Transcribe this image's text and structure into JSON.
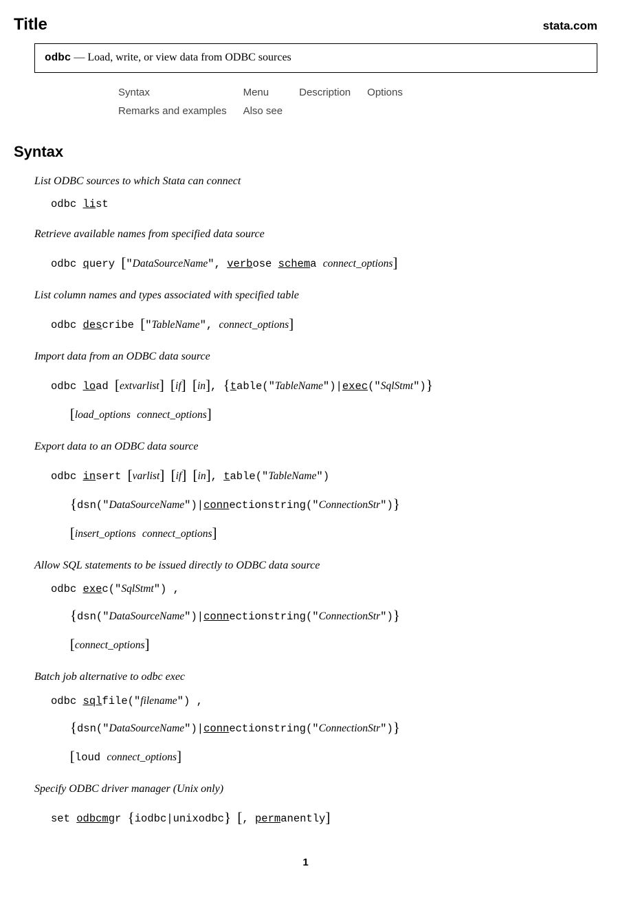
{
  "header": {
    "title": "Title",
    "site": "stata.com"
  },
  "titlebox": {
    "cmd": "odbc",
    "dash": " — ",
    "desc": "Load, write, or view data from ODBC sources"
  },
  "nav": {
    "r1c1": "Syntax",
    "r1c2": "Menu",
    "r1c3": "Description",
    "r1c4": "Options",
    "r2c1": "Remarks and examples",
    "r2c2": "Also see"
  },
  "section": "Syntax",
  "e1": {
    "desc": "List ODBC sources to which Stata can connect"
  },
  "e2": {
    "desc": "Retrieve available names from specified data source"
  },
  "e3": {
    "desc": "List column names and types associated with specified table"
  },
  "e4": {
    "desc": "Import data from an ODBC data source"
  },
  "e5": {
    "desc": "Export data to an ODBC data source"
  },
  "e6": {
    "desc": "Allow SQL statements to be issued directly to ODBC data source"
  },
  "e7": {
    "desc": "Batch job alternative to odbc exec"
  },
  "e8": {
    "desc": "Specify ODBC driver manager (Unix only)"
  },
  "t": {
    "odbc": "odbc ",
    "set": "set ",
    "li": "li",
    "st": "st",
    "q": "q",
    "uery": "uery ",
    "des": "des",
    "cribe": "cribe ",
    "lo": "lo",
    "ad": "ad ",
    "in": "in",
    "sertw": "sert ",
    "exe": "exe",
    "cw": "c",
    "sql": "sql",
    "filew": "file",
    "odbcmg": "odbcmg",
    "r": "r ",
    "verb": "verb",
    "ose": "ose ",
    "schem": "schem",
    "a": "a ",
    "t_": "t",
    "ablep": "able(",
    "exec_u": "exec",
    "p": "(",
    "conn": "conn",
    "ectionstring": "ectionstring(",
    "dsn": "dsn(",
    "perm": "perm",
    "anently": "anently",
    "iodbc": "iodbc",
    "unixodbc": "unixodbc",
    "loud": "loud ",
    "q1": "\"",
    "q2": "\"",
    "comma": ", ",
    "commaNs": ",",
    "pipe": "|",
    "cp": ")",
    "sp": " ",
    "DataSourceName": "DataSourceName",
    "TableName": "TableName",
    "SqlStmt": "SqlStmt",
    "ConnectionStr": "ConnectionStr",
    "filename": "filename",
    "connect_options": "connect_options",
    "load_options": "load_options",
    "insert_options": "insert_options",
    "extvarlist": "extvarlist",
    "varlist": "varlist",
    "if": "if",
    "in_it": "in"
  },
  "pagenum": "1"
}
